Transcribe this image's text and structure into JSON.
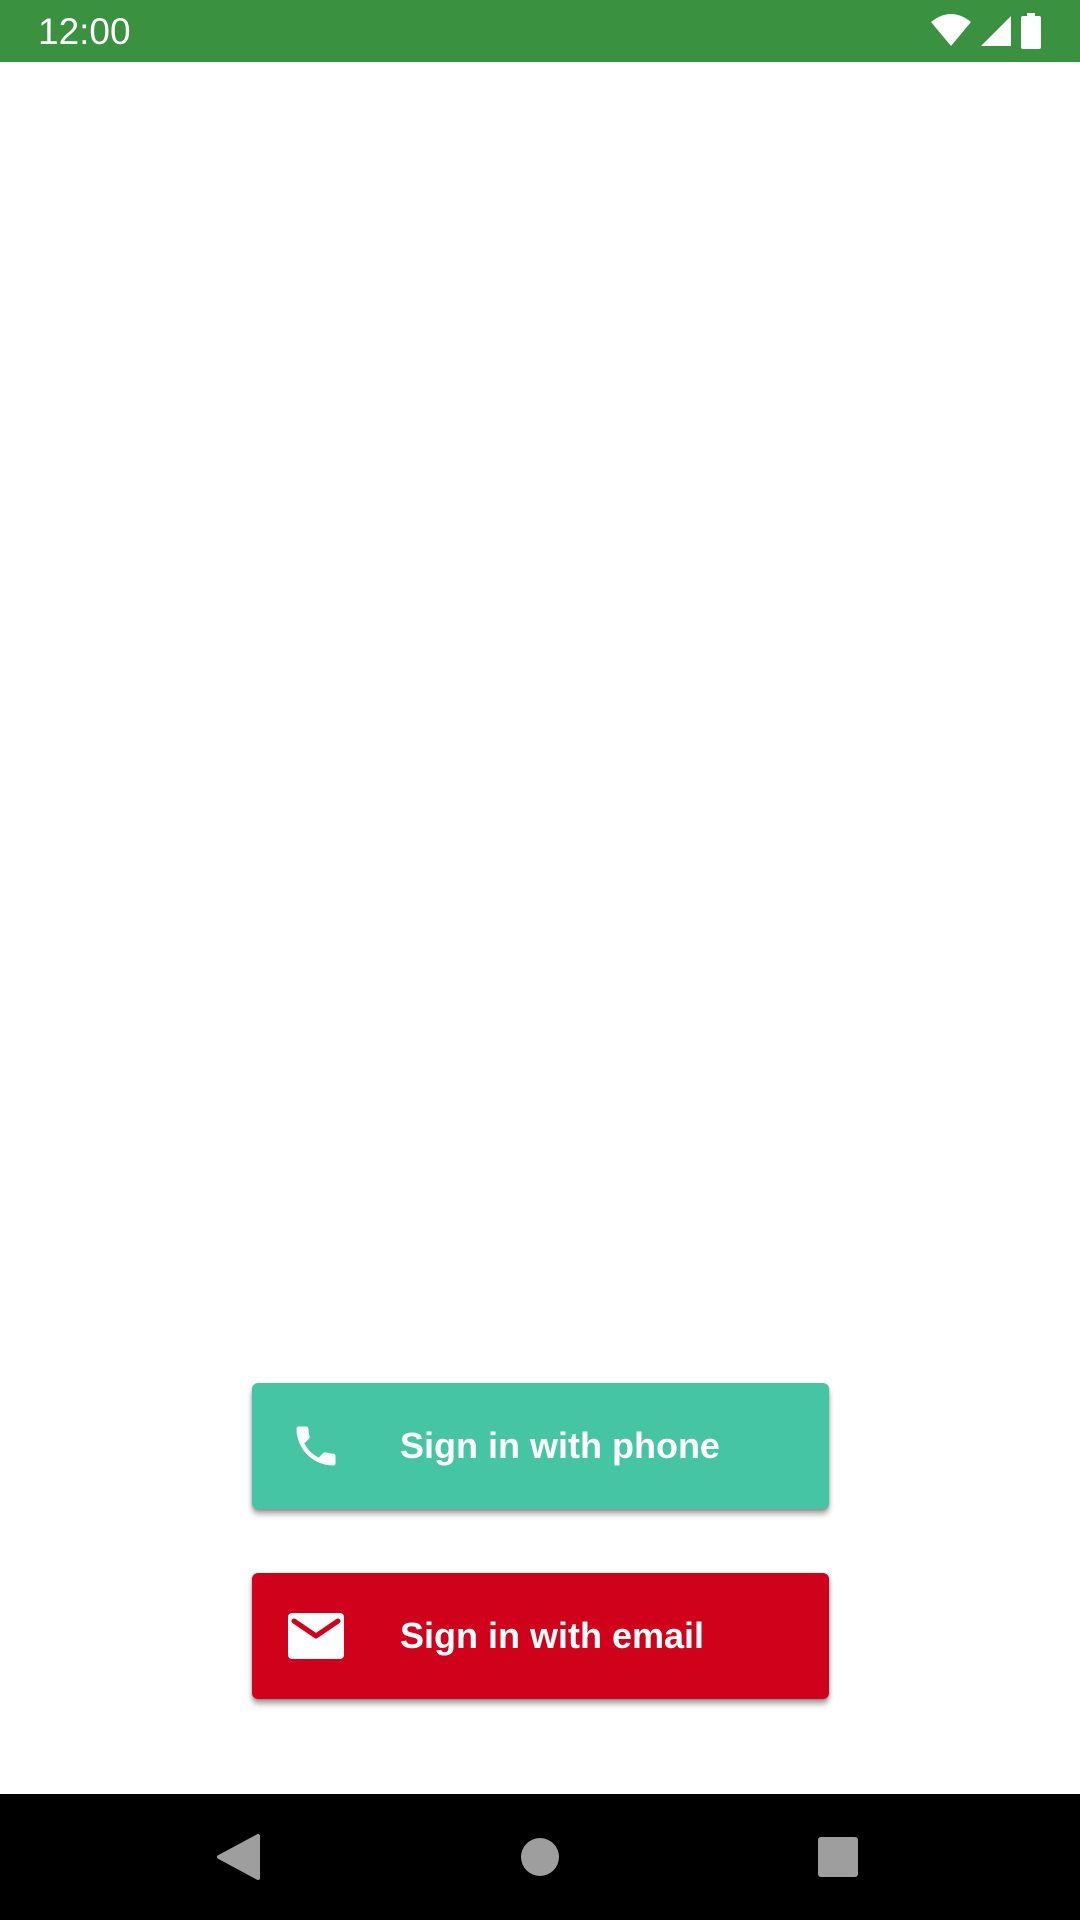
{
  "status_bar": {
    "time": "12:00",
    "background_color": "#3a9140",
    "icons": [
      "wifi-icon",
      "cellular-signal-icon",
      "battery-icon"
    ]
  },
  "actions": {
    "phone": {
      "label": "Sign in with phone",
      "icon": "phone-icon",
      "color": "#46c5a5"
    },
    "email": {
      "label": "Sign in with email",
      "icon": "email-icon",
      "color": "#d0021b"
    }
  },
  "nav_bar": {
    "buttons": [
      "back-icon",
      "home-icon",
      "recents-icon"
    ]
  }
}
